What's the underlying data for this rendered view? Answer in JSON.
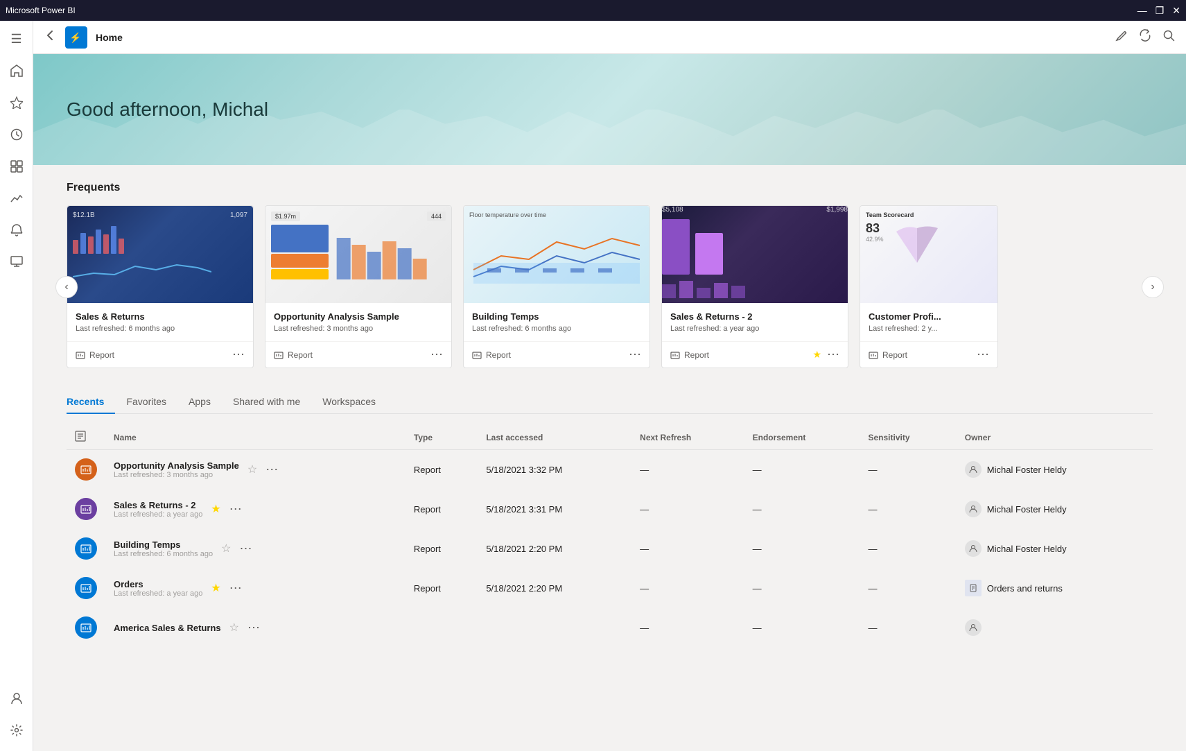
{
  "titlebar": {
    "title": "Microsoft Power BI",
    "minimize": "—",
    "restore": "❐",
    "close": "✕"
  },
  "topnav": {
    "back_label": "←",
    "page_title": "Home",
    "refresh_icon": "↻",
    "search_icon": "🔍"
  },
  "hero": {
    "greeting": "Good afternoon, Michal"
  },
  "frequents": {
    "title": "Frequents",
    "cards": [
      {
        "id": "sales-returns",
        "title": "Sales & Returns",
        "subtitle": "Last refreshed: 6 months ago",
        "type": "Report",
        "starred": false,
        "thumb_color": "sales"
      },
      {
        "id": "opportunity",
        "title": "Opportunity Analysis Sample",
        "subtitle": "Last refreshed: 3 months ago",
        "type": "Report",
        "starred": false,
        "thumb_color": "opp"
      },
      {
        "id": "building-temps",
        "title": "Building Temps",
        "subtitle": "Last refreshed: 6 months ago",
        "type": "Report",
        "starred": false,
        "thumb_color": "building"
      },
      {
        "id": "sales-returns-2",
        "title": "Sales & Returns - 2",
        "subtitle": "Last refreshed: a year ago",
        "type": "Report",
        "starred": true,
        "thumb_color": "sales2"
      },
      {
        "id": "customer-profi",
        "title": "Customer Profi...",
        "subtitle": "Last refreshed: 2 y...",
        "type": "Report",
        "starred": false,
        "thumb_color": "customer"
      }
    ]
  },
  "recents": {
    "tabs": [
      {
        "id": "recents",
        "label": "Recents",
        "active": true
      },
      {
        "id": "favorites",
        "label": "Favorites",
        "active": false
      },
      {
        "id": "apps",
        "label": "Apps",
        "active": false
      },
      {
        "id": "shared",
        "label": "Shared with me",
        "active": false
      },
      {
        "id": "workspaces",
        "label": "Workspaces",
        "active": false
      }
    ],
    "columns": [
      "",
      "Name",
      "Type",
      "Last accessed",
      "Next Refresh",
      "Endorsement",
      "Sensitivity",
      "Owner"
    ],
    "rows": [
      {
        "icon_color": "orange",
        "icon_letter": "📊",
        "name": "Opportunity Analysis Sample",
        "sub": "Last refreshed: 3 months ago",
        "type": "Report",
        "last_accessed": "5/18/2021 3:32 PM",
        "next_refresh": "—",
        "endorsement": "—",
        "sensitivity": "—",
        "owner": "Michal Foster Heldy",
        "starred": false
      },
      {
        "icon_color": "purple",
        "icon_letter": "📊",
        "name": "Sales & Returns  - 2",
        "sub": "Last refreshed: a year ago",
        "type": "Report",
        "last_accessed": "5/18/2021 3:31 PM",
        "next_refresh": "—",
        "endorsement": "—",
        "sensitivity": "—",
        "owner": "Michal Foster Heldy",
        "starred": true
      },
      {
        "icon_color": "blue",
        "icon_letter": "📊",
        "name": "Building Temps",
        "sub": "Last refreshed: 6 months ago",
        "type": "Report",
        "last_accessed": "5/18/2021 2:20 PM",
        "next_refresh": "—",
        "endorsement": "—",
        "sensitivity": "—",
        "owner": "Michal Foster Heldy",
        "starred": false
      },
      {
        "icon_color": "blue",
        "icon_letter": "📊",
        "name": "Orders",
        "sub": "Last refreshed: a year ago",
        "type": "Report",
        "last_accessed": "5/18/2021 2:20 PM",
        "next_refresh": "—",
        "endorsement": "—",
        "sensitivity": "—",
        "owner": "Orders and returns",
        "owner_icon": "doc",
        "starred": true
      },
      {
        "icon_color": "blue",
        "icon_letter": "📊",
        "name": "America Sales & Returns",
        "sub": "",
        "type": "",
        "last_accessed": "",
        "next_refresh": "—",
        "endorsement": "—",
        "sensitivity": "—",
        "owner": "",
        "starred": false
      }
    ]
  },
  "sidebar": {
    "items": [
      {
        "id": "home",
        "icon": "⊞",
        "label": "Home",
        "active": false
      },
      {
        "id": "favorites",
        "icon": "☆",
        "label": "Favorites",
        "active": false
      },
      {
        "id": "recents",
        "icon": "🕐",
        "label": "Recents",
        "active": false
      },
      {
        "id": "apps",
        "icon": "⊡",
        "label": "Apps",
        "active": false
      },
      {
        "id": "metrics",
        "icon": "📈",
        "label": "Metrics",
        "active": false
      },
      {
        "id": "alerts",
        "icon": "🔔",
        "label": "Alerts",
        "active": false
      },
      {
        "id": "workspaces",
        "icon": "🗂",
        "label": "Workspaces",
        "active": false
      }
    ],
    "bottom": [
      {
        "id": "profile",
        "icon": "👤",
        "label": "Profile"
      },
      {
        "id": "settings",
        "icon": "⚙",
        "label": "Settings"
      }
    ]
  }
}
